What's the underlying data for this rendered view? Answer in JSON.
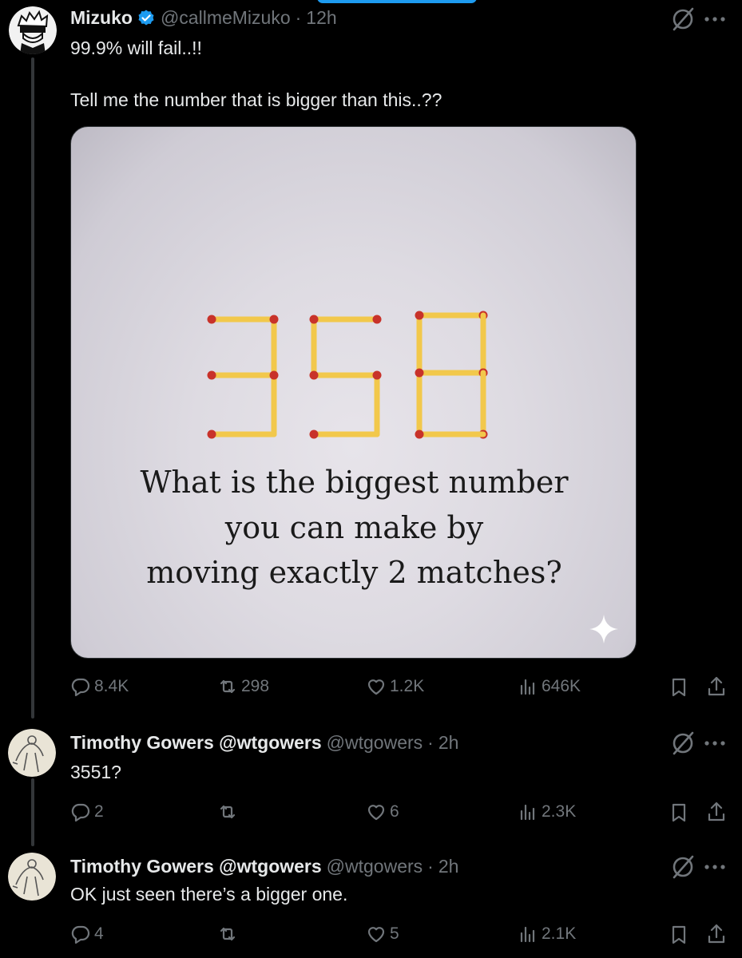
{
  "tweets": [
    {
      "name": "Mizuko",
      "handle": "@callmeMizuko",
      "time": "12h",
      "verified": true,
      "lines": [
        "99.9% will fail..!!",
        "Tell me the number that is bigger than this..??"
      ],
      "media": {
        "puzzle_lines": [
          "What is the biggest number",
          "you can make by",
          "moving exactly 2 matches?"
        ],
        "sparkle_icon": "sparkle-icon"
      },
      "stats": {
        "replies": "8.4K",
        "reposts": "298",
        "likes": "1.2K",
        "views": "646K"
      }
    },
    {
      "name": "Timothy Gowers @wtgowers",
      "handle": "@wtgowers",
      "time": "2h",
      "lines": [
        "3551?"
      ],
      "stats": {
        "replies": "2",
        "reposts": "",
        "likes": "6",
        "views": "2.3K"
      }
    },
    {
      "name": "Timothy Gowers @wtgowers",
      "handle": "@wtgowers",
      "time": "2h",
      "lines": [
        "OK just seen there’s a bigger one."
      ],
      "stats": {
        "replies": "4",
        "reposts": "",
        "likes": "5",
        "views": "2.1K"
      }
    }
  ],
  "separator": "·",
  "colors": {
    "background": "#000000",
    "text": "#e7e9ea",
    "muted": "#71767b",
    "accent": "#1d9bf0",
    "match": "#f2c84b",
    "match_head": "#c8322a"
  }
}
